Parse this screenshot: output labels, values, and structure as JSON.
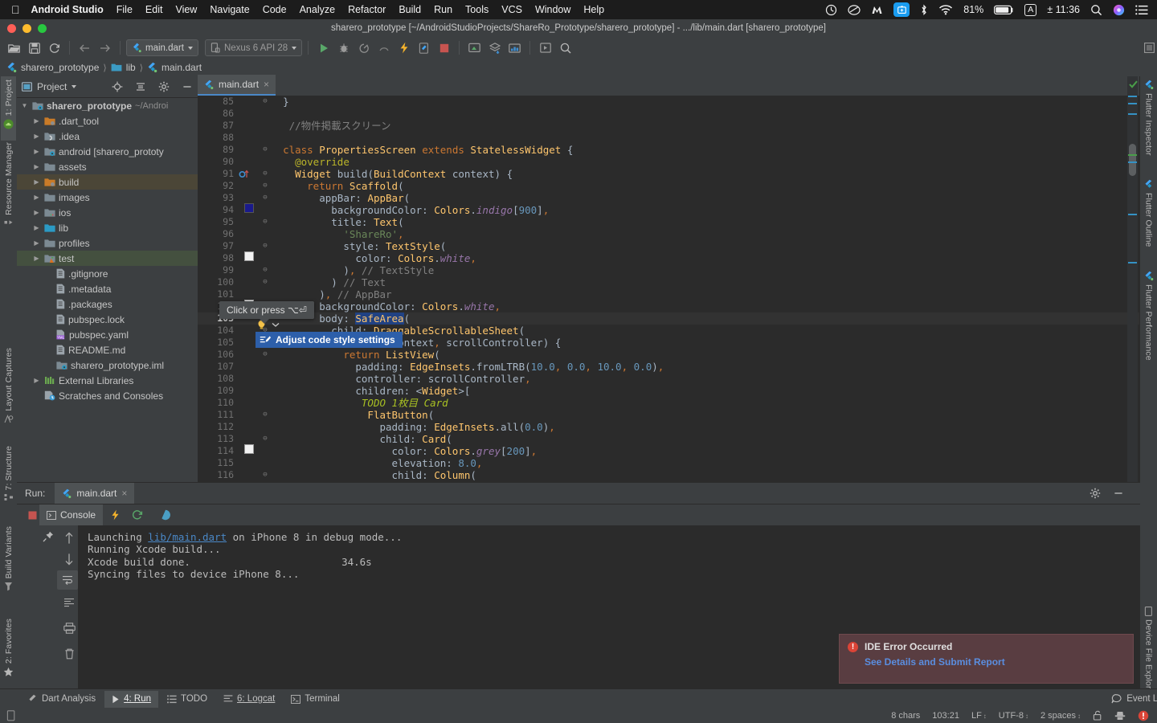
{
  "macbar": {
    "apple_icon": "apple-logo-icon",
    "app_name": "Android Studio",
    "menus": [
      "File",
      "Edit",
      "View",
      "Navigate",
      "Code",
      "Analyze",
      "Refactor",
      "Build",
      "Run",
      "Tools",
      "VCS",
      "Window",
      "Help"
    ],
    "status_icons": [
      "timer-icon",
      "creative-cloud-icon",
      "malwarebytes-icon",
      "screenshot-tool-icon",
      "bluetooth-icon",
      "wifi-icon"
    ],
    "battery_percent": "81%",
    "input_source": "A",
    "clock": "± 11:36",
    "search_icon": "search-icon",
    "siri_icon": "siri-icon",
    "control_center_icon": "list-menu-icon"
  },
  "window": {
    "title": "sharero_prototype [~/AndroidStudioProjects/ShareRo_Prototype/sharero_prototype] - .../lib/main.dart [sharero_prototype]"
  },
  "toolbar": {
    "buttons": [
      "open-folder-icon",
      "save-all-icon",
      "sync-icon",
      "back-arrow-icon",
      "forward-arrow-icon"
    ],
    "run_config": "main.dart",
    "device": "Nexus 6 API 28",
    "actions": [
      "run-icon",
      "debug-icon",
      "run-coverage-icon",
      "profile-icon",
      "hot-reload-icon",
      "flutter-attach-icon",
      "stop-icon",
      "avd-manager-icon",
      "sdk-manager-icon",
      "project-structure-icon",
      "layout-inspector-icon",
      "search-everywhere-icon"
    ]
  },
  "breadcrumb": {
    "items": [
      {
        "label": "sharero_prototype",
        "icon": "flutter-icon"
      },
      {
        "label": "lib",
        "icon": "folder-icon"
      },
      {
        "label": "main.dart",
        "icon": "dart-file-icon"
      }
    ]
  },
  "left_strip": {
    "items": [
      "1: Project",
      "Resource Manager",
      "Layout Captures",
      "7: Structure",
      "Build Variants",
      "2: Favorites"
    ]
  },
  "right_strip": {
    "items": [
      "Flutter Inspector",
      "Flutter Outline",
      "Flutter Performance",
      "Device File Explorer"
    ]
  },
  "project_panel": {
    "title": "Project",
    "header_icons": [
      "locate-icon",
      "collapse-all-icon",
      "settings-gear-icon",
      "hide-icon"
    ],
    "tree": [
      {
        "label": "sharero_prototype",
        "suffix": "~/Androi",
        "depth": 0,
        "icon": "module-icon",
        "arrow": "down",
        "bold": true
      },
      {
        "label": ".dart_tool",
        "depth": 1,
        "icon": "folder-orange-icon",
        "arrow": "right"
      },
      {
        "label": ".idea",
        "depth": 1,
        "icon": "folder-idea-icon",
        "arrow": "right"
      },
      {
        "label": "android [sharero_prototy",
        "depth": 1,
        "icon": "module-icon",
        "arrow": "right"
      },
      {
        "label": "assets",
        "depth": 1,
        "icon": "folder-icon",
        "arrow": "right"
      },
      {
        "label": "build",
        "depth": 1,
        "icon": "folder-orange-icon",
        "arrow": "right",
        "state": "build"
      },
      {
        "label": "images",
        "depth": 1,
        "icon": "folder-icon",
        "arrow": "right"
      },
      {
        "label": "ios",
        "depth": 1,
        "icon": "folder-ios-icon",
        "arrow": "right"
      },
      {
        "label": "lib",
        "depth": 1,
        "icon": "folder-source-icon",
        "arrow": "right"
      },
      {
        "label": "profiles",
        "depth": 1,
        "icon": "folder-icon",
        "arrow": "right"
      },
      {
        "label": "test",
        "depth": 1,
        "icon": "folder-test-icon",
        "arrow": "right",
        "state": "test"
      },
      {
        "label": ".gitignore",
        "depth": 2,
        "icon": "file-icon"
      },
      {
        "label": ".metadata",
        "depth": 2,
        "icon": "file-icon"
      },
      {
        "label": ".packages",
        "depth": 2,
        "icon": "file-icon"
      },
      {
        "label": "pubspec.lock",
        "depth": 2,
        "icon": "file-icon"
      },
      {
        "label": "pubspec.yaml",
        "depth": 2,
        "icon": "yaml-file-icon"
      },
      {
        "label": "README.md",
        "depth": 2,
        "icon": "file-icon"
      },
      {
        "label": "sharero_prototype.iml",
        "depth": 2,
        "icon": "module-file-icon"
      },
      {
        "label": "External Libraries",
        "depth": 1,
        "icon": "libraries-icon",
        "arrow": "right"
      },
      {
        "label": "Scratches and Consoles",
        "depth": 1,
        "icon": "scratches-icon"
      }
    ]
  },
  "editor": {
    "tab": {
      "label": "main.dart",
      "icon": "dart-file-icon",
      "close": "×"
    },
    "first_line_number": 85,
    "current_line": 103,
    "lines": [
      {
        "n": 85,
        "text": "}",
        "indent": 2
      },
      {
        "n": 86,
        "text": "",
        "indent": 0
      },
      {
        "n": 87,
        "text": "//物件掲載スクリーン",
        "indent": 3
      },
      {
        "n": 88,
        "text": "",
        "indent": 0
      },
      {
        "n": 89,
        "text": "class PropertiesScreen extends StatelessWidget {",
        "indent": 2
      },
      {
        "n": 90,
        "text": "@override",
        "indent": 4
      },
      {
        "n": 91,
        "text": "Widget build(BuildContext context) {",
        "indent": 4
      },
      {
        "n": 92,
        "text": "return Scaffold(",
        "indent": 6
      },
      {
        "n": 93,
        "text": "appBar: AppBar(",
        "indent": 8
      },
      {
        "n": 94,
        "text": "backgroundColor: Colors.indigo[900],",
        "indent": 10
      },
      {
        "n": 95,
        "text": "title: Text(",
        "indent": 10
      },
      {
        "n": 96,
        "text": "'ShareRo',",
        "indent": 12
      },
      {
        "n": 97,
        "text": "style: TextStyle(",
        "indent": 12
      },
      {
        "n": 98,
        "text": "color: Colors.white,",
        "indent": 14
      },
      {
        "n": 99,
        "text": "), // TextStyle",
        "indent": 12
      },
      {
        "n": 100,
        "text": ") // Text",
        "indent": 10
      },
      {
        "n": 101,
        "text": "), // AppBar",
        "indent": 8
      },
      {
        "n": 102,
        "text": "backgroundColor: Colors.white,",
        "indent": 8
      },
      {
        "n": 103,
        "text": "body: SafeArea(",
        "indent": 8
      },
      {
        "n": 104,
        "text": "child: DraggableScrollableSheet(",
        "indent": 10
      },
      {
        "n": 105,
        "text": "builder: (context, scrollController) {",
        "indent": 10
      },
      {
        "n": 106,
        "text": "return ListView(",
        "indent": 12
      },
      {
        "n": 107,
        "text": "padding: EdgeInsets.fromLTRB(10.0, 0.0, 10.0, 0.0),",
        "indent": 14
      },
      {
        "n": 108,
        "text": "controller: scrollController,",
        "indent": 14
      },
      {
        "n": 109,
        "text": "children: <Widget>[",
        "indent": 14
      },
      {
        "n": 110,
        "text": "TODO 1枚目 Card",
        "indent": 15
      },
      {
        "n": 111,
        "text": "FlatButton(",
        "indent": 16
      },
      {
        "n": 112,
        "text": "padding: EdgeInsets.all(0.0),",
        "indent": 18
      },
      {
        "n": 113,
        "text": "child: Card(",
        "indent": 18
      },
      {
        "n": 114,
        "text": "color: Colors.grey[200],",
        "indent": 20
      },
      {
        "n": 115,
        "text": "elevation: 8.0,",
        "indent": 20
      },
      {
        "n": 116,
        "text": "child: Column(",
        "indent": 20
      }
    ],
    "tooltip": "Click or press ⌥⏎",
    "intention": {
      "label": "Adjust code style settings",
      "icon": "code-style-icon"
    },
    "bulb_icon": "lightbulb-icon"
  },
  "run_panel": {
    "label": "Run:",
    "tab": {
      "label": "main.dart",
      "icon": "dart-file-icon",
      "close": "×"
    },
    "console_tab": "Console",
    "toolbar_icons": [
      "stop-icon",
      "hot-reload-icon",
      "hot-restart-icon",
      "open-observatory-icon"
    ],
    "side_icons": [
      "pin-icon",
      "up-arrow-icon",
      "down-arrow-icon",
      "soft-wrap-icon",
      "scroll-to-end-icon",
      "print-icon",
      "trash-icon"
    ],
    "settings_icon": "settings-gear-icon",
    "hide_icon": "hide-icon",
    "console_lines": [
      [
        {
          "t": "Launching ",
          "k": "plain"
        },
        {
          "t": "lib/main.dart",
          "k": "link"
        },
        {
          "t": " on iPhone 8 in debug mode...",
          "k": "plain"
        }
      ],
      [
        {
          "t": "Running Xcode build...",
          "k": "plain"
        }
      ],
      [
        {
          "t": "Xcode build done.",
          "k": "plain"
        },
        {
          "t": "                         34.6s",
          "k": "plain"
        }
      ],
      [
        {
          "t": "Syncing files to device iPhone 8...",
          "k": "plain"
        }
      ]
    ]
  },
  "error_balloon": {
    "icon": "error-icon",
    "title": "IDE Error Occurred",
    "link": "See Details and Submit Report"
  },
  "bottom_bar": {
    "items": [
      {
        "label": "Dart Analysis",
        "icon": "dart-analysis-icon",
        "active": false
      },
      {
        "label": "4: Run",
        "icon": "run-icon",
        "active": true,
        "underline": "4"
      },
      {
        "label": "TODO",
        "icon": "todo-icon",
        "active": false
      },
      {
        "label": "6: Logcat",
        "icon": "logcat-icon",
        "active": false,
        "underline": "6"
      },
      {
        "label": "Terminal",
        "icon": "terminal-icon",
        "active": false
      }
    ],
    "event_log": {
      "label": "Event Log",
      "icon": "event-log-icon"
    }
  },
  "status_bar": {
    "chars": "8 chars",
    "caret": "103:21",
    "line_separator": "LF",
    "encoding": "UTF-8",
    "indent": "2 spaces",
    "icons": [
      "lock-open-icon",
      "inspector-hat-icon",
      "error-badge-icon"
    ]
  },
  "colors": {
    "accent": "#4a88c7",
    "error": "#db4437",
    "intention": "#2d5faa",
    "panel_bg": "#3c3f41",
    "editor_bg": "#2b2b2b"
  }
}
